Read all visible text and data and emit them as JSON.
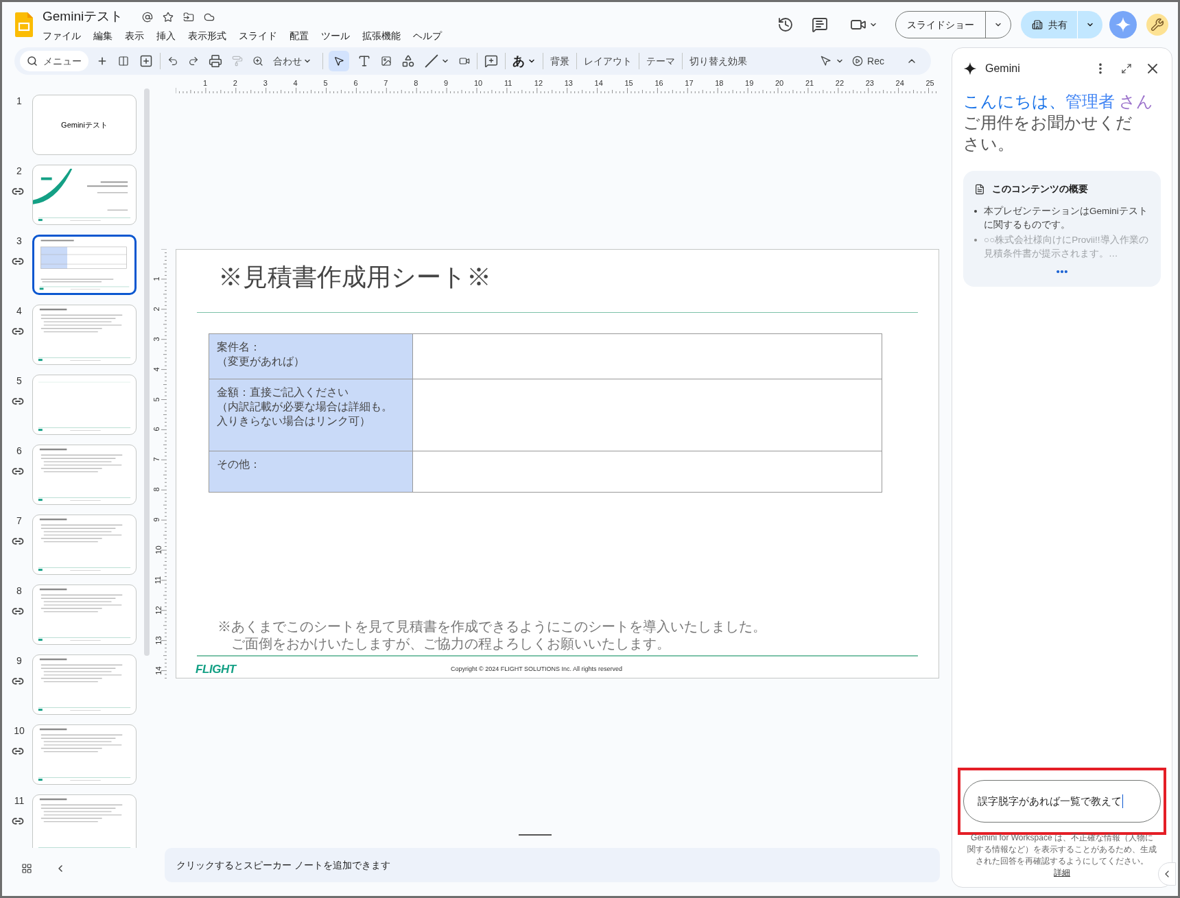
{
  "document": {
    "title": "Geminiテスト"
  },
  "menu": [
    "ファイル",
    "編集",
    "表示",
    "挿入",
    "表示形式",
    "スライド",
    "配置",
    "ツール",
    "拡張機能",
    "ヘルプ"
  ],
  "header": {
    "slideshow_label": "スライドショー",
    "share_label": "共有"
  },
  "toolbar": {
    "search_label": "メニュー",
    "zoom_label": "合わせ",
    "pointer_selected": true,
    "paint_format_disabled": true,
    "font_label": "あ",
    "text_buttons": [
      "背景",
      "レイアウト",
      "テーマ",
      "切り替え効果"
    ],
    "rec_label": "Rec"
  },
  "slides": [
    {
      "number": "1",
      "kind": "title",
      "title": "Geminiテスト",
      "selected": false,
      "linked": false
    },
    {
      "number": "2",
      "kind": "cover",
      "selected": false,
      "linked": true
    },
    {
      "number": "3",
      "kind": "table",
      "selected": true,
      "linked": true
    },
    {
      "number": "4",
      "kind": "text",
      "selected": false,
      "linked": true
    },
    {
      "number": "5",
      "kind": "blank",
      "selected": false,
      "linked": true
    },
    {
      "number": "6",
      "kind": "text",
      "selected": false,
      "linked": true
    },
    {
      "number": "7",
      "kind": "text",
      "selected": false,
      "linked": true
    },
    {
      "number": "8",
      "kind": "text",
      "selected": false,
      "linked": true
    },
    {
      "number": "9",
      "kind": "text",
      "selected": false,
      "linked": true
    },
    {
      "number": "10",
      "kind": "text",
      "selected": false,
      "linked": true
    },
    {
      "number": "11",
      "kind": "text",
      "selected": false,
      "linked": true
    }
  ],
  "ruler": {
    "horizontal": [
      "1",
      "2",
      "3",
      "4",
      "5",
      "6",
      "7",
      "8",
      "9",
      "10",
      "11",
      "12",
      "13",
      "14",
      "15",
      "16",
      "17",
      "18",
      "19",
      "20",
      "21",
      "22",
      "23",
      "24",
      "25"
    ],
    "vertical": [
      "1",
      "2",
      "3",
      "4",
      "5",
      "6",
      "7",
      "8",
      "9",
      "10",
      "11",
      "12",
      "13",
      "14"
    ]
  },
  "slide": {
    "title": "※見積書作成用シート※",
    "table": [
      {
        "label": [
          "案件名：",
          "（変更があれば）"
        ]
      },
      {
        "label": [
          "金額：直接ご記入ください",
          "（内訳記載が必要な場合は詳細も。",
          "入りきらない場合はリンク可）"
        ]
      },
      {
        "label": [
          "その他："
        ]
      }
    ],
    "note": [
      "※あくまでこのシートを見て見積書を作成できるようにこのシートを導入いたしました。",
      "ご面倒をおかけいたしますが、ご協力の程よろしくお願いいたします。"
    ],
    "logo": "FLIGHT",
    "copyright": "Copyright ©  2024 FLIGHT SOLUTIONS Inc. All rights reserved"
  },
  "speaker_notes": {
    "placeholder": "クリックするとスピーカー ノートを追加できます"
  },
  "gemini": {
    "title": "Gemini",
    "greeting": [
      "こんにちは、",
      "管理者",
      "さん"
    ],
    "prompt": "ご用件をお聞かせください。",
    "summary": {
      "title": "このコンテンツの概要",
      "bullets": [
        {
          "text": "本プレゼンテーションはGeminiテストに関するものです。",
          "faded": false
        },
        {
          "text": "○○株式会社様向けにProvii!!導入作業の見積条件書が提示されます。…",
          "faded": true
        }
      ]
    },
    "input": {
      "value": "誤字脱字があれば一覧で教えて",
      "highlighted": true
    },
    "disclaimer": "Gemini for Workspace は、不正確な情報（人物に関する情報など）を表示することがあるため、生成された回答を再確認するようにしてください。",
    "link": "詳細"
  }
}
